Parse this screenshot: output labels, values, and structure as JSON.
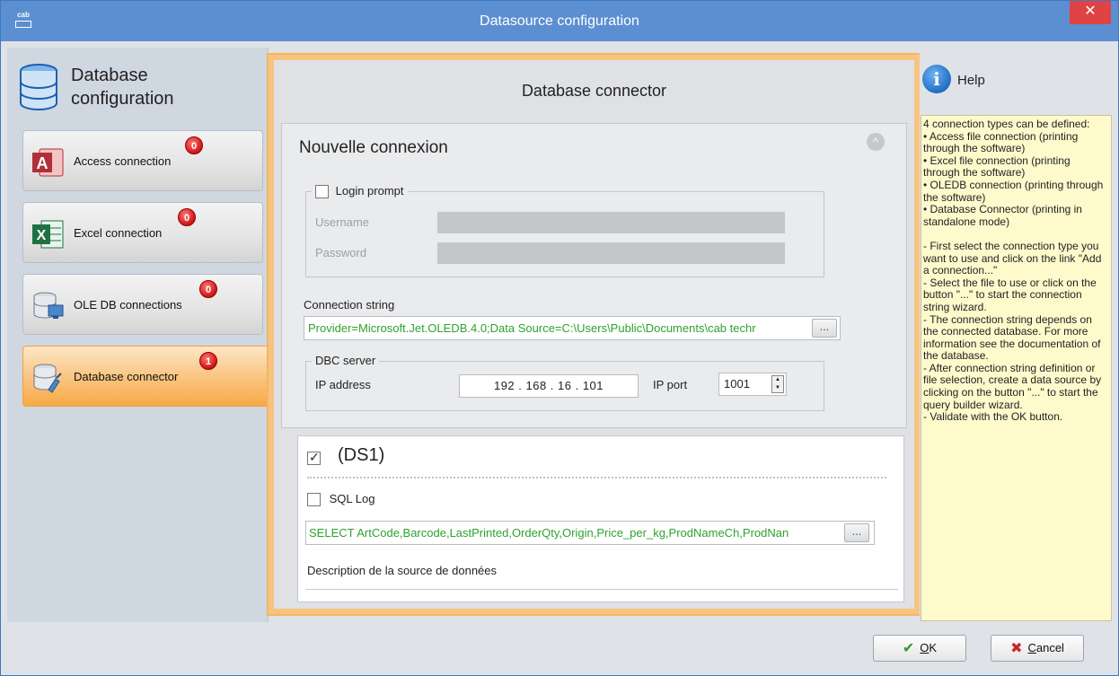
{
  "window": {
    "title": "Datasource configuration",
    "close_glyph": "✕",
    "app_logo_text": "cab"
  },
  "nav": {
    "header": {
      "line1": "Database",
      "line2": "configuration"
    },
    "items": [
      {
        "label": "Access connection",
        "badge": "0",
        "icon": "access-icon"
      },
      {
        "label": "Excel connection",
        "badge": "0",
        "icon": "excel-icon"
      },
      {
        "label": "OLE DB connections",
        "badge": "0",
        "icon": "oledb-icon"
      },
      {
        "label": "Database connector",
        "badge": "1",
        "icon": "database-connector-icon",
        "active": true
      }
    ]
  },
  "center": {
    "heading": "Database connector",
    "connection": {
      "title": "Nouvelle connexion",
      "collapse_glyph": "^",
      "login_prompt_label": "Login prompt",
      "login_prompt_checked": false,
      "username_label": "Username",
      "password_label": "Password",
      "connection_string_label": "Connection string",
      "connection_string": "Provider=Microsoft.Jet.OLEDB.4.0;Data Source=C:\\Users\\Public\\Documents\\cab techr",
      "browse_label": "...",
      "dbc_server_label": "DBC server",
      "ip_address_label": "IP address",
      "ip_address": "192  .  168  .  16  .  101",
      "ip_port_label": "IP port",
      "ip_port": "1001"
    },
    "datasource": {
      "checked": true,
      "title": "(DS1)",
      "sql_log_label": "SQL Log",
      "sql_log_checked": false,
      "query": "SELECT ArtCode,Barcode,LastPrinted,OrderQty,Origin,Price_per_kg,ProdNameCh,ProdNan",
      "browse_label": "...",
      "description_label": "Description de la source de données"
    }
  },
  "help": {
    "title": "Help",
    "lines": [
      "4 connection types can be defined:",
      "• Access file connection (printing through the software)",
      "• Excel file connection (printing through the software)",
      "• OLEDB connection (printing through the software)",
      "• Database Connector (printing in standalone mode)",
      "",
      "- First select the connection type you want to use and click on the link \"Add a connection...\"",
      "- Select the file to use or click on the button \"...\" to start the connection string wizard.",
      "- The connection string depends on the connected database. For more information see the documentation of the database.",
      "- After connection string definition or file selection, create a data source by clicking on the button \"...\" to start the query builder wizard.",
      "- Validate with the OK button."
    ]
  },
  "footer": {
    "ok": {
      "mnemonic": "O",
      "rest": "K"
    },
    "cancel": {
      "mnemonic": "C",
      "rest": "ancel"
    }
  },
  "colors": {
    "accent": "#5b8fd2",
    "active_item": "#f7a945",
    "badge": "#d21b1b",
    "green_text": "#2ea22e"
  }
}
